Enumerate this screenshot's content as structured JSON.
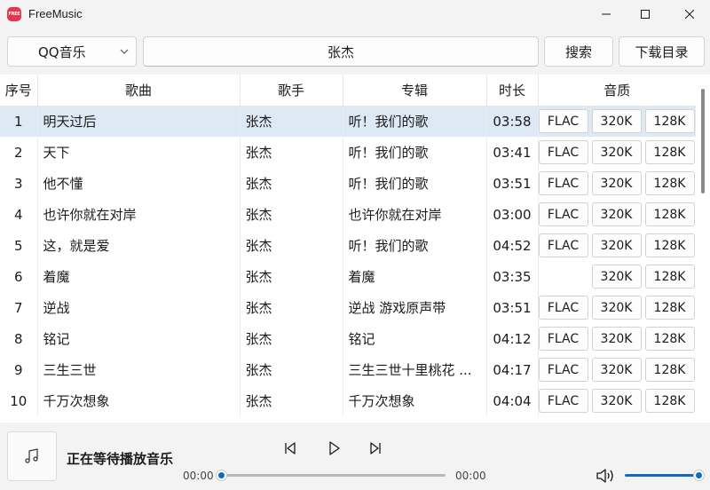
{
  "window": {
    "title": "FreeMusic",
    "logo_text": "FREE"
  },
  "toolbar": {
    "source": "QQ音乐",
    "search_value": "张杰",
    "search_button": "搜索",
    "download_dir_button": "下载目录"
  },
  "table": {
    "headers": {
      "index": "序号",
      "song": "歌曲",
      "artist": "歌手",
      "album": "专辑",
      "duration": "时长",
      "quality": "音质"
    },
    "rows": [
      {
        "index": "1",
        "song": "明天过后",
        "artist": "张杰",
        "album": "听！我们的歌",
        "duration": "03:58",
        "q1": "FLAC",
        "q2": "320K",
        "q3": "128K"
      },
      {
        "index": "2",
        "song": "天下",
        "artist": "张杰",
        "album": "听！我们的歌",
        "duration": "03:41",
        "q1": "FLAC",
        "q2": "320K",
        "q3": "128K"
      },
      {
        "index": "3",
        "song": "他不懂",
        "artist": "张杰",
        "album": "听！我们的歌",
        "duration": "03:51",
        "q1": "FLAC",
        "q2": "320K",
        "q3": "128K"
      },
      {
        "index": "4",
        "song": "也许你就在对岸",
        "artist": "张杰",
        "album": "也许你就在对岸",
        "duration": "03:00",
        "q1": "FLAC",
        "q2": "320K",
        "q3": "128K"
      },
      {
        "index": "5",
        "song": "这，就是爱",
        "artist": "张杰",
        "album": "听！我们的歌",
        "duration": "04:52",
        "q1": "FLAC",
        "q2": "320K",
        "q3": "128K"
      },
      {
        "index": "6",
        "song": "着魔",
        "artist": "张杰",
        "album": "着魔",
        "duration": "03:35",
        "q1": "",
        "q2": "320K",
        "q3": "128K"
      },
      {
        "index": "7",
        "song": "逆战",
        "artist": "张杰",
        "album": "逆战 游戏原声带",
        "duration": "03:51",
        "q1": "FLAC",
        "q2": "320K",
        "q3": "128K"
      },
      {
        "index": "8",
        "song": "铭记",
        "artist": "张杰",
        "album": "铭记",
        "duration": "04:12",
        "q1": "FLAC",
        "q2": "320K",
        "q3": "128K"
      },
      {
        "index": "9",
        "song": "三生三世",
        "artist": "张杰",
        "album": "三生三世十里桃花 ...",
        "duration": "04:17",
        "q1": "FLAC",
        "q2": "320K",
        "q3": "128K"
      },
      {
        "index": "10",
        "song": "千万次想象",
        "artist": "张杰",
        "album": "千万次想象",
        "duration": "04:04",
        "q1": "FLAC",
        "q2": "320K",
        "q3": "128K"
      }
    ]
  },
  "player": {
    "status": "正在等待播放音乐",
    "current_time": "00:00",
    "total_time": "00:00",
    "progress": 0,
    "volume": 1.0
  },
  "colors": {
    "accent": "#0f6cbd",
    "selected_row": "#dde9f5",
    "logo": "#e8344e"
  },
  "icons": [
    "app-logo",
    "minimize-icon",
    "maximize-icon",
    "close-icon",
    "chevron-down-icon",
    "music-note-icon",
    "previous-icon",
    "play-icon",
    "next-icon",
    "volume-icon"
  ]
}
